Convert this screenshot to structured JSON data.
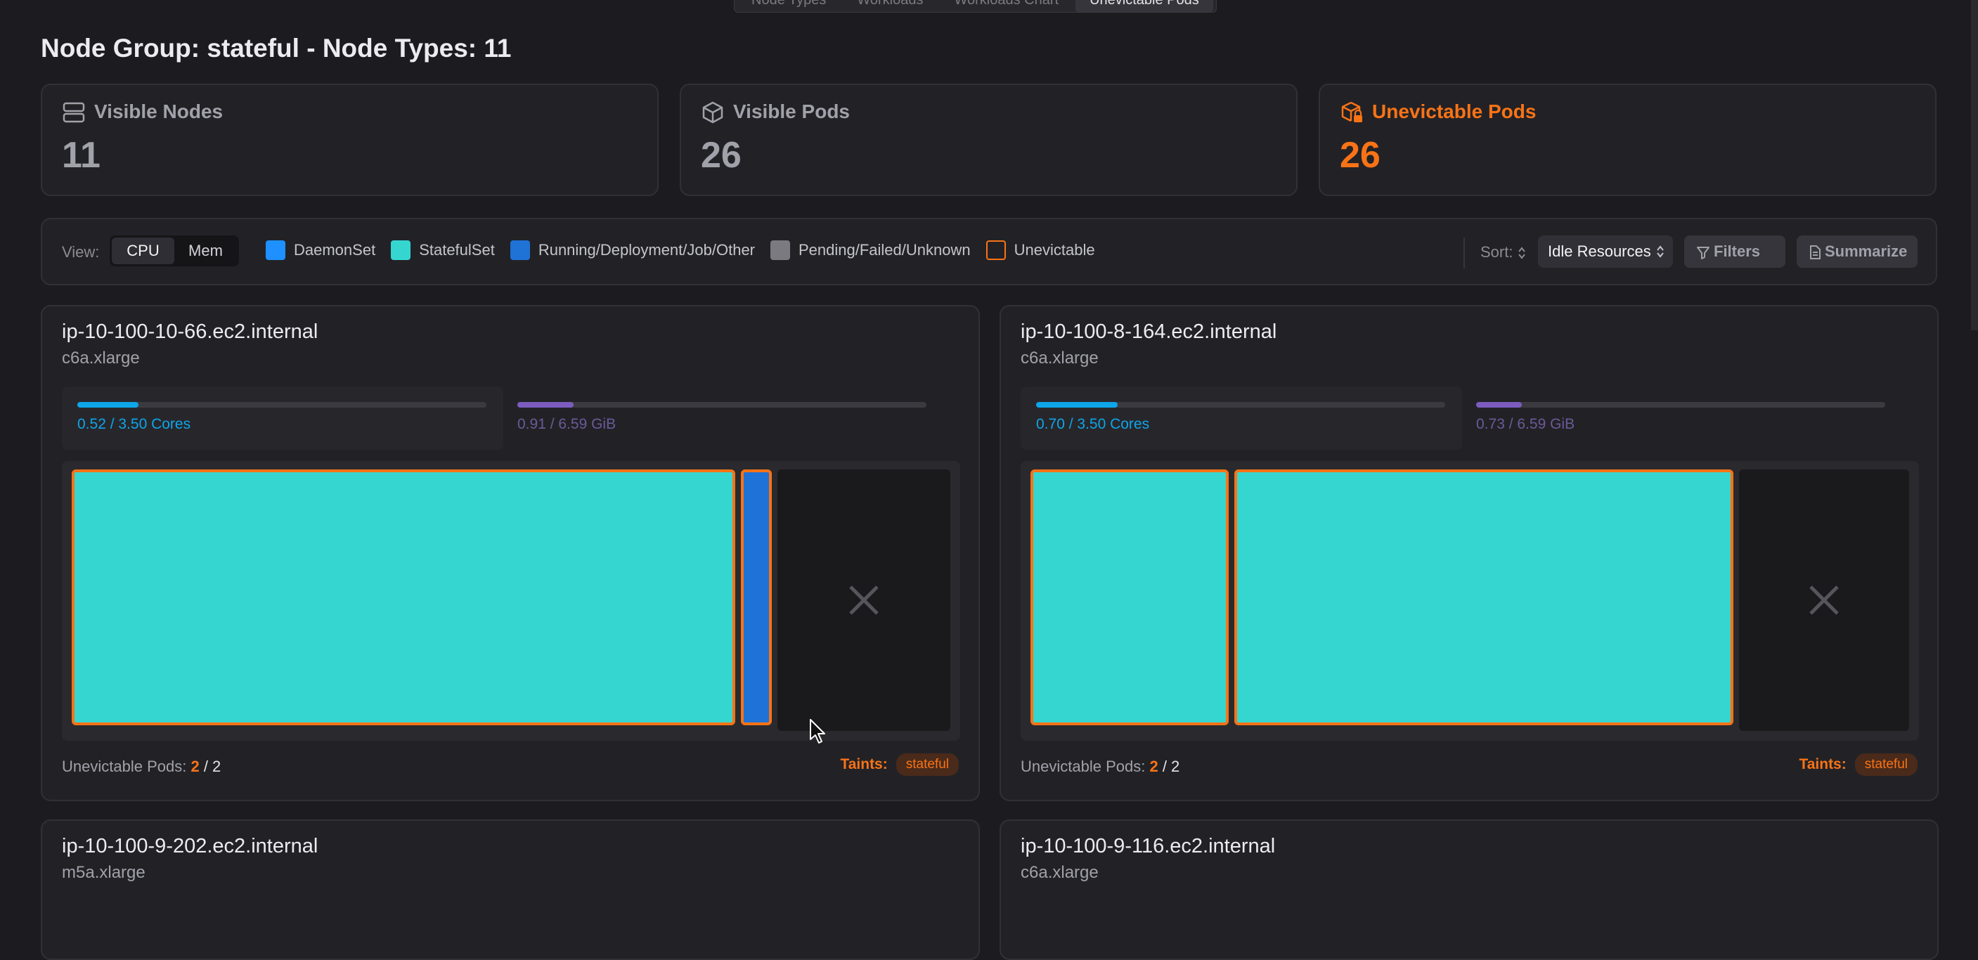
{
  "top_tabs": [
    "Node Types",
    "Workloads",
    "Workloads Chart",
    "Unevictable Pods"
  ],
  "active_tab_index": 3,
  "group_title": "Node Group: stateful - Node Types: 11",
  "stats": [
    {
      "label": "Visible Nodes",
      "value": "11",
      "icon": "server-icon"
    },
    {
      "label": "Visible Pods",
      "value": "26",
      "icon": "cube-icon"
    },
    {
      "label": "Unevictable Pods",
      "value": "26",
      "icon": "locked-package-icon"
    }
  ],
  "toolbar": {
    "view_label": "View:",
    "view_options": [
      "CPU",
      "Mem"
    ],
    "view_selected": "CPU",
    "legend": [
      {
        "label": "DaemonSet",
        "color": "#1e90ff"
      },
      {
        "label": "StatefulSet",
        "color": "#36d6d0"
      },
      {
        "label": "Running/Deployment/Job/Other",
        "color": "#1f72d6"
      },
      {
        "label": "Pending/Failed/Unknown",
        "color": "#7a7a80"
      },
      {
        "label": "Unevictable",
        "color": "#f97316"
      }
    ],
    "sort_label": "Sort:",
    "sort_value": "Idle Resources",
    "filters_label": "Filters",
    "summarize_label": "Summarize"
  },
  "colors": {
    "accent": "#f97316",
    "cpu_bar": "#0ea5e9",
    "mem_bar": "#7c5cbf",
    "statefulset": "#36d6d0",
    "running": "#1f72d6"
  },
  "nodes": [
    {
      "name": "ip-10-100-10-66.ec2.internal",
      "type": "c6a.xlarge",
      "cpu_text": "0.52 / 3.50 Cores",
      "cpu_fraction": 0.149,
      "mem_text": "0.91 / 6.59 GiB",
      "mem_fraction": 0.138,
      "pods": [
        {
          "kind": "StatefulSet",
          "cpu_share": 0.79
        },
        {
          "kind": "Running/Deployment/Job/Other",
          "cpu_share": 0.035
        }
      ],
      "unevictable_label": "Unevictable Pods:",
      "unevictable_count": "2",
      "unevictable_total": "2",
      "taints_label": "Taints:",
      "taints": [
        "stateful"
      ]
    },
    {
      "name": "ip-10-100-8-164.ec2.internal",
      "type": "c6a.xlarge",
      "cpu_text": "0.70 / 3.50 Cores",
      "cpu_fraction": 0.2,
      "mem_text": "0.73 / 6.59 GiB",
      "mem_fraction": 0.111,
      "pods": [
        {
          "kind": "StatefulSet",
          "cpu_share": 0.23
        },
        {
          "kind": "StatefulSet",
          "cpu_share": 0.59
        }
      ],
      "unevictable_label": "Unevictable Pods:",
      "unevictable_count": "2",
      "unevictable_total": "2",
      "taints_label": "Taints:",
      "taints": [
        "stateful"
      ]
    },
    {
      "name": "ip-10-100-9-202.ec2.internal",
      "type": "m5a.xlarge"
    },
    {
      "name": "ip-10-100-9-116.ec2.internal",
      "type": "c6a.xlarge"
    }
  ]
}
